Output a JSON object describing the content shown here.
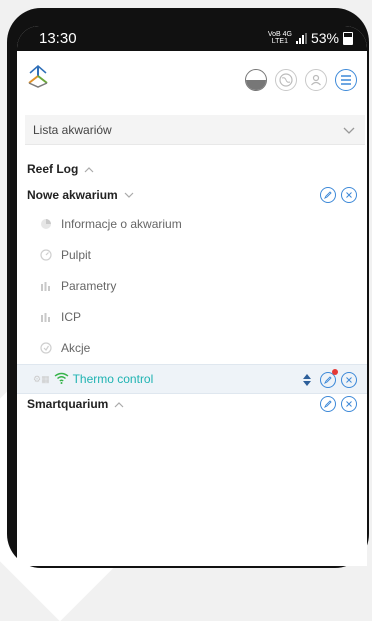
{
  "status": {
    "time": "13:30",
    "network_top": "VoB 4G",
    "network_bottom": "LTE1",
    "battery": "53%"
  },
  "header": {
    "logo_icon": "aquarium-logo-icon",
    "icons": [
      "water-level-icon",
      "globe-icon",
      "user-icon",
      "menu-icon"
    ]
  },
  "dropdown": {
    "label": "Lista akwariów"
  },
  "groups": {
    "reef": {
      "label": "Reef Log"
    },
    "nowe": {
      "label": "Nowe akwarium",
      "items": [
        {
          "label": "Informacje o akwarium",
          "icon": "pie-chart-icon"
        },
        {
          "label": "Pulpit",
          "icon": "dashboard-icon"
        },
        {
          "label": "Parametry",
          "icon": "bar-chart-icon"
        },
        {
          "label": "ICP",
          "icon": "bar-chart-icon"
        },
        {
          "label": "Akcje",
          "icon": "action-icon"
        }
      ]
    },
    "thermo": {
      "label": "Thermo control",
      "icon": "wifi-icon"
    },
    "smart": {
      "label": "Smartquarium"
    }
  },
  "colors": {
    "accent_blue": "#3d89d8",
    "teal": "#1fb3b2",
    "notification": "#e53935"
  }
}
